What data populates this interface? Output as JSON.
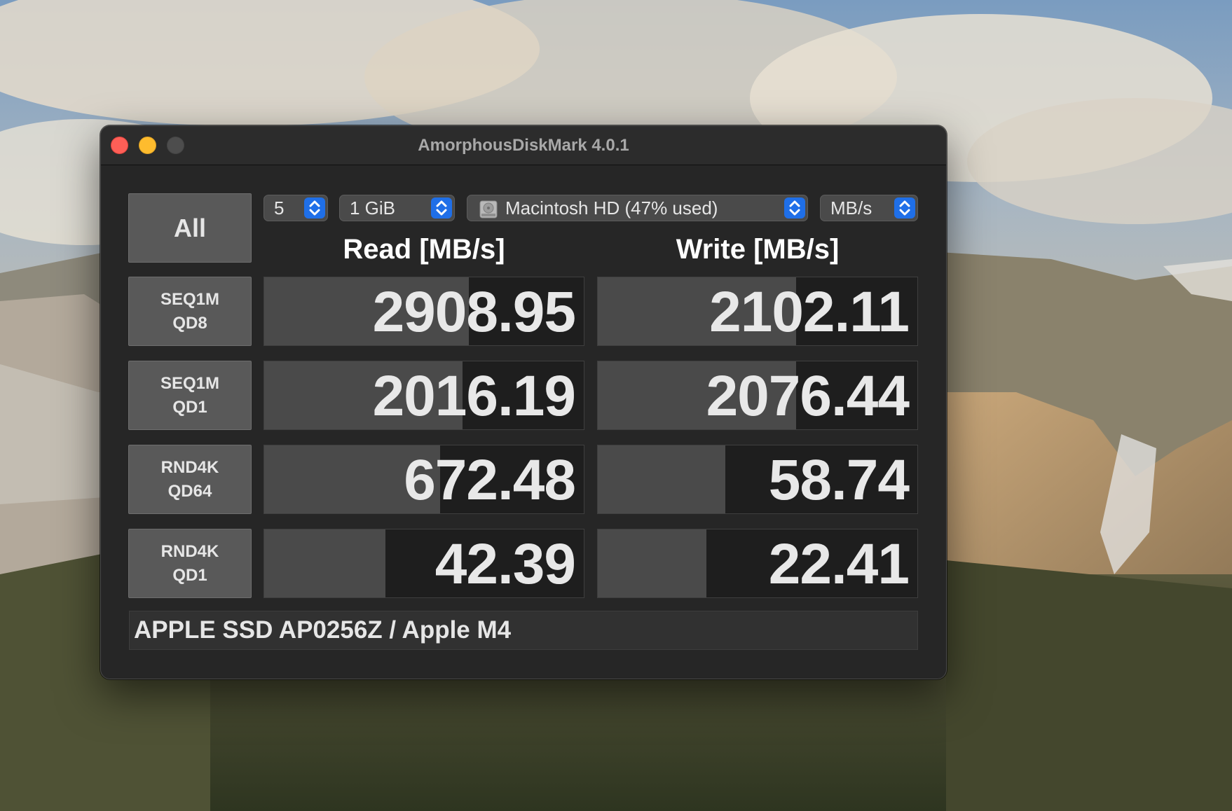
{
  "window": {
    "title": "AmorphousDiskMark 4.0.1"
  },
  "controls": {
    "all_label": "All",
    "count": "5",
    "size": "1 GiB",
    "drive": "Macintosh HD (47% used)",
    "unit": "MB/s"
  },
  "columns": {
    "read": "Read [MB/s]",
    "write": "Write [MB/s]"
  },
  "tests": [
    {
      "line1": "SEQ1M",
      "line2": "QD8",
      "read": "2908.95",
      "write": "2102.11",
      "read_fill": 0.64,
      "write_fill": 0.62
    },
    {
      "line1": "SEQ1M",
      "line2": "QD1",
      "read": "2016.19",
      "write": "2076.44",
      "read_fill": 0.62,
      "write_fill": 0.62
    },
    {
      "line1": "RND4K",
      "line2": "QD64",
      "read": "672.48",
      "write": "58.74",
      "read_fill": 0.55,
      "write_fill": 0.4
    },
    {
      "line1": "RND4K",
      "line2": "QD1",
      "read": "42.39",
      "write": "22.41",
      "read_fill": 0.38,
      "write_fill": 0.34
    }
  ],
  "footer": {
    "device": "APPLE SSD AP0256Z / Apple M4"
  },
  "colors": {
    "close": "#fe5f57",
    "minimize": "#febc2e",
    "accent": "#1f6fe8",
    "bar_fill": "#4a4a4a",
    "cell_bg": "#1e1e1e"
  }
}
